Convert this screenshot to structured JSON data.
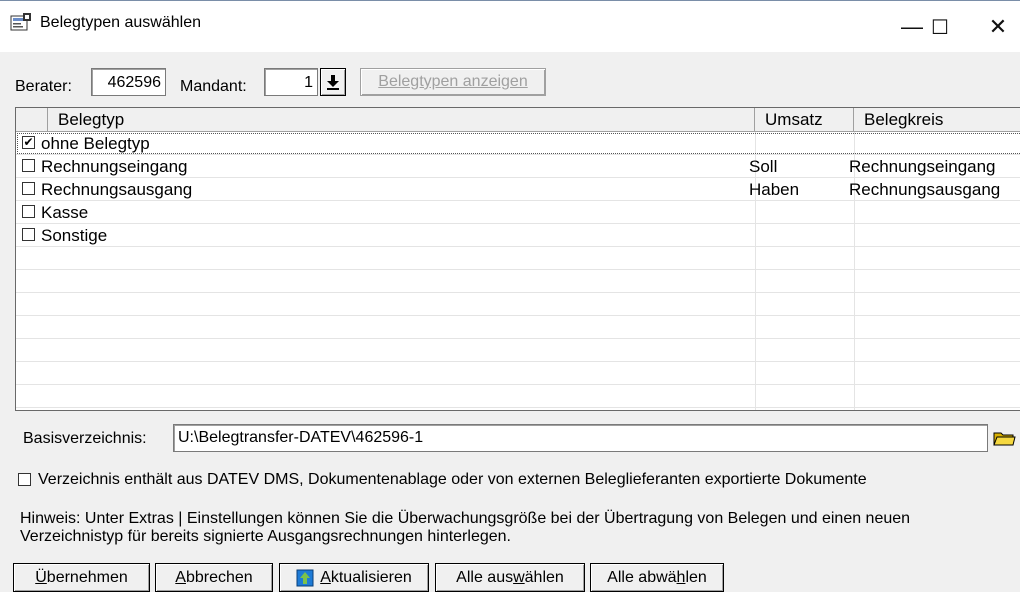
{
  "window": {
    "title": "Belegtypen auswählen",
    "minimize": "—",
    "maximize": "☐",
    "close": "✕"
  },
  "filter": {
    "berater_label": "Berater:",
    "berater_value": "462596",
    "mandant_label": "Mandant:",
    "mandant_value": "1",
    "show_button": "Belegtypen anzeigen"
  },
  "table": {
    "columns": [
      "Belegtyp",
      "Umsatz",
      "Belegkreis"
    ],
    "rows": [
      {
        "checked": true,
        "belegtyp": "ohne Belegtyp",
        "umsatz": "",
        "belegkreis": ""
      },
      {
        "checked": false,
        "belegtyp": "Rechnungseingang",
        "umsatz": "Soll",
        "belegkreis": "Rechnungseingang"
      },
      {
        "checked": false,
        "belegtyp": "Rechnungsausgang",
        "umsatz": "Haben",
        "belegkreis": "Rechnungsausgang"
      },
      {
        "checked": false,
        "belegtyp": "Kasse",
        "umsatz": "",
        "belegkreis": ""
      },
      {
        "checked": false,
        "belegtyp": "Sonstige",
        "umsatz": "",
        "belegkreis": ""
      }
    ]
  },
  "basis": {
    "label": "Basisverzeichnis:",
    "value": "U:\\Belegtransfer-DATEV\\462596-1"
  },
  "option": {
    "label": "Verzeichnis enthält aus DATEV DMS, Dokumentenablage oder von externen Beleglieferanten exportierte Dokumente",
    "checked": false
  },
  "hint": {
    "line1": "Hinweis: Unter Extras | Einstellungen können Sie die Überwachungsgröße bei der Übertragung von Belegen und einen neuen",
    "line2": "Verzeichnistyp für bereits signierte Ausgangsrechnungen hinterlegen."
  },
  "buttons": {
    "uebernehmen_u": "Ü",
    "uebernehmen_rest": "bernehmen",
    "abbrechen_u": "A",
    "abbrechen_rest": "bbrechen",
    "aktualisieren_u": "A",
    "aktualisieren_rest": "ktualisieren",
    "alle_auswaehlen_a": "Alle aus",
    "alle_auswaehlen_u": "w",
    "alle_auswaehlen_b": "ählen",
    "alle_abwaehlen_a": "Alle abwä",
    "alle_abwaehlen_u": "h",
    "alle_abwaehlen_b": "len"
  }
}
